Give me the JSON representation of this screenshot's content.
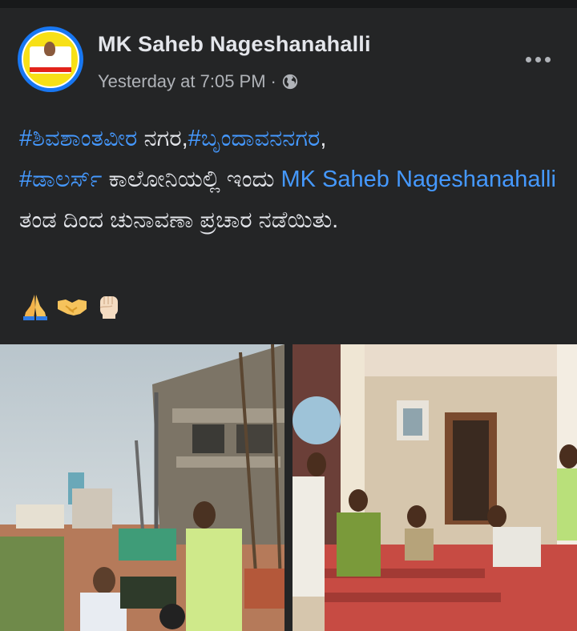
{
  "post": {
    "author": "MK Saheb Nageshanahalli",
    "timestamp": "Yesterday at 7:05 PM",
    "separator": "·",
    "privacy_icon": "globe-icon",
    "more_icon": "more-options-icon",
    "text": {
      "hashtag1": "#ಶಿವಶಾಂತವೀರ",
      "t1": " ನಗರ,",
      "hashtag2": "#ಬೃಂದಾವನನಗರ",
      "t2": ",",
      "hashtag3": "#ಡಾಲರ್ಸ್",
      "t3": " ಕಾಲೋನಿಯಲ್ಲಿ ಇಂದು ",
      "mention": "MK Saheb Nageshanahalli",
      "t4": " ತಂಡ ದಿಂದ ಚುನಾವಣಾ ಪ್ರಚಾರ ನಡೆಯಿತು."
    },
    "emojis": [
      "folded-hands-icon",
      "handshake-icon",
      "raised-fist-icon"
    ]
  },
  "colors": {
    "background": "#242526",
    "link": "#4599ff",
    "primary_text": "#e4e6eb",
    "secondary_text": "#b0b3b8"
  }
}
